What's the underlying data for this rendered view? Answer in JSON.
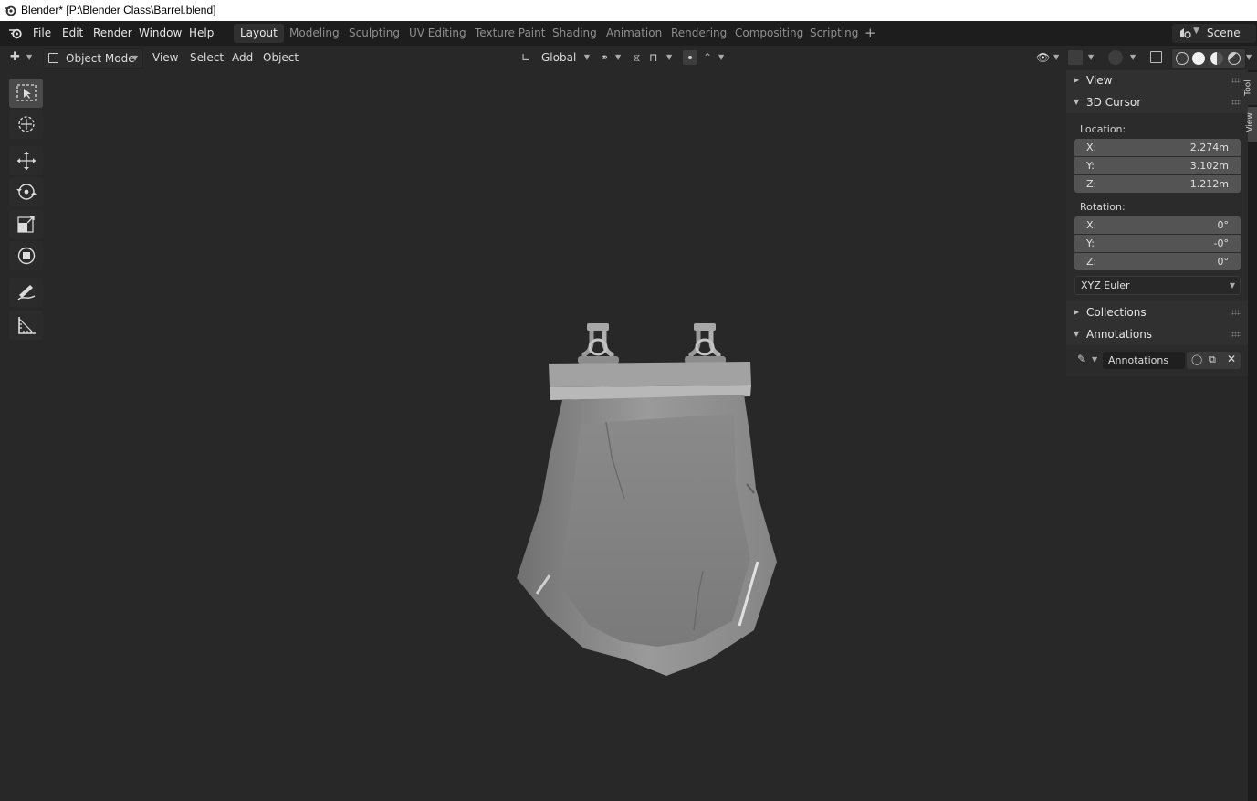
{
  "window": {
    "title": "Blender* [P:\\Blender Class\\Barrel.blend]"
  },
  "topbar": {
    "menus": [
      "File",
      "Edit",
      "Render",
      "Window",
      "Help"
    ],
    "workspaces": [
      "Layout",
      "Modeling",
      "Sculpting",
      "UV Editing",
      "Texture Paint",
      "Shading",
      "Animation",
      "Rendering",
      "Compositing",
      "Scripting"
    ],
    "active_workspace": "Layout",
    "add_workspace": "+",
    "scene": "Scene"
  },
  "header": {
    "mode": "Object Mode",
    "menus": [
      "View",
      "Select",
      "Add",
      "Object"
    ],
    "orientation": "Global"
  },
  "toolbar": {
    "tools": [
      "select-box-icon",
      "cursor-icon",
      "move-icon",
      "rotate-icon",
      "scale-icon",
      "transform-icon",
      "annotate-icon",
      "measure-icon"
    ],
    "active": "select-box-icon"
  },
  "sidebar": {
    "tabs": [
      "Tool",
      "View"
    ],
    "panels": {
      "view": "View",
      "cursor": "3D Cursor",
      "location_label": "Location:",
      "location": [
        {
          "axis": "X:",
          "value": "2.274m"
        },
        {
          "axis": "Y:",
          "value": "3.102m"
        },
        {
          "axis": "Z:",
          "value": "1.212m"
        }
      ],
      "rotation_label": "Rotation:",
      "rotation": [
        {
          "axis": "X:",
          "value": "0°"
        },
        {
          "axis": "Y:",
          "value": "-0°"
        },
        {
          "axis": "Z:",
          "value": "0°"
        }
      ],
      "rotation_mode": "XYZ Euler",
      "collections": "Collections",
      "annotations": "Annotations",
      "annotation_layer": "Annotations"
    }
  },
  "colors": {
    "viewport_bg": "#282828",
    "topbar_bg": "#1d1d1d",
    "panel_bg": "#303030",
    "field_bg": "#545454"
  }
}
